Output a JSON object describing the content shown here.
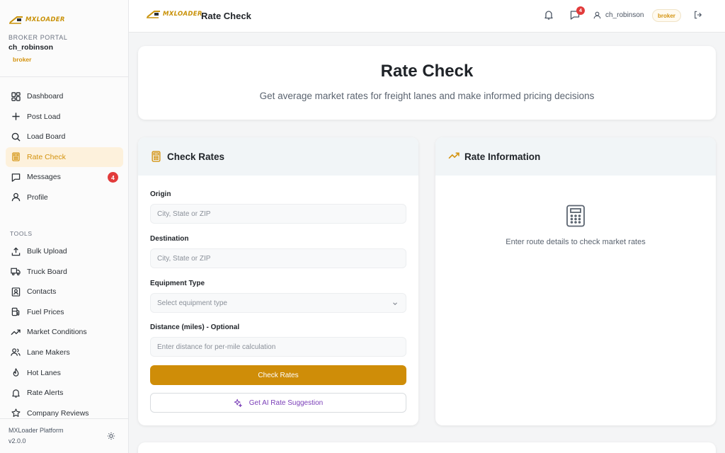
{
  "app": {
    "logo_text": "MXLOADER",
    "portal_label": "BROKER PORTAL",
    "username": "ch_robinson",
    "role": "broker",
    "platform": "MXLoader Platform",
    "version": "v2.0.0"
  },
  "sidebar": {
    "nav": [
      {
        "label": "Dashboard",
        "icon": "dashboard-icon"
      },
      {
        "label": "Post Load",
        "icon": "plus-icon"
      },
      {
        "label": "Load Board",
        "icon": "search-icon"
      },
      {
        "label": "Rate Check",
        "icon": "calculator-icon",
        "active": true
      },
      {
        "label": "Messages",
        "icon": "message-icon",
        "badge": "4"
      },
      {
        "label": "Profile",
        "icon": "user-icon"
      }
    ],
    "tools_label": "TOOLS",
    "tools": [
      {
        "label": "Bulk Upload",
        "icon": "upload-icon"
      },
      {
        "label": "Truck Board",
        "icon": "truck-icon"
      },
      {
        "label": "Contacts",
        "icon": "contacts-icon"
      },
      {
        "label": "Fuel Prices",
        "icon": "fuel-icon"
      },
      {
        "label": "Market Conditions",
        "icon": "trending-up-icon"
      },
      {
        "label": "Lane Makers",
        "icon": "users-icon"
      },
      {
        "label": "Hot Lanes",
        "icon": "flame-icon"
      },
      {
        "label": "Rate Alerts",
        "icon": "bell-icon"
      },
      {
        "label": "Company Reviews",
        "icon": "star-icon"
      }
    ]
  },
  "header": {
    "title": "Rate Check",
    "message_badge": "4",
    "username": "ch_robinson",
    "role": "broker"
  },
  "hero": {
    "title": "Rate Check",
    "subtitle": "Get average market rates for freight lanes and make informed pricing decisions"
  },
  "check_rates": {
    "title": "Check Rates",
    "origin_label": "Origin",
    "origin_placeholder": "City, State or ZIP",
    "destination_label": "Destination",
    "destination_placeholder": "City, State or ZIP",
    "equipment_label": "Equipment Type",
    "equipment_placeholder": "Select equipment type",
    "distance_label": "Distance (miles) - Optional",
    "distance_placeholder": "Enter distance for per-mile calculation",
    "submit_label": "Check Rates",
    "ai_label": "Get AI Rate Suggestion"
  },
  "rate_info": {
    "title": "Rate Information",
    "empty_text": "Enter route details to check market rates"
  },
  "colors": {
    "accent": "#d4930f",
    "primary_button": "#cf8d08",
    "badge": "#e23b3b",
    "ai": "#7b3fb8"
  }
}
